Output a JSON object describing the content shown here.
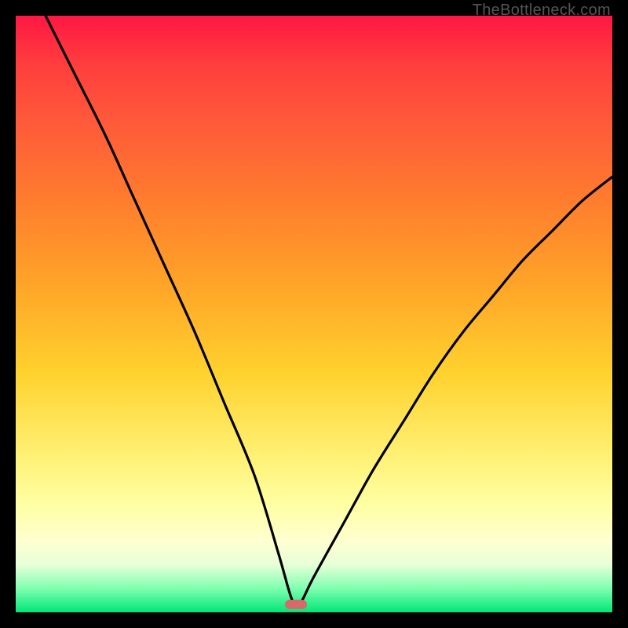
{
  "watermark": "TheBottleneck.com",
  "colors": {
    "frame_bg": "#000000",
    "curve": "#000000",
    "marker": "#d66a6a",
    "gradient_stops": [
      {
        "pct": 0,
        "color": "#ff1744"
      },
      {
        "pct": 8,
        "color": "#ff3d3d"
      },
      {
        "pct": 18,
        "color": "#ff5a3a"
      },
      {
        "pct": 30,
        "color": "#ff7a2e"
      },
      {
        "pct": 45,
        "color": "#ffa428"
      },
      {
        "pct": 60,
        "color": "#ffd22e"
      },
      {
        "pct": 74,
        "color": "#fff176"
      },
      {
        "pct": 82,
        "color": "#ffffa3"
      },
      {
        "pct": 88,
        "color": "#ffffd0"
      },
      {
        "pct": 92,
        "color": "#e8ffd8"
      },
      {
        "pct": 96,
        "color": "#7fffb0"
      },
      {
        "pct": 100,
        "color": "#00e676"
      }
    ]
  },
  "chart_data": {
    "type": "line",
    "title": "",
    "xlabel": "",
    "ylabel": "",
    "xlim": [
      0,
      100
    ],
    "ylim": [
      0,
      100
    ],
    "note": "x and y in percent of plot area; y = 0 at bottom (green), y = 100 at top (red). Single V-shaped curve with minimum near x≈47.",
    "series": [
      {
        "name": "bottleneck-curve",
        "x": [
          5,
          10,
          15,
          20,
          25,
          30,
          35,
          40,
          44,
          46,
          47,
          48,
          50,
          55,
          60,
          65,
          70,
          75,
          80,
          85,
          90,
          95,
          100
        ],
        "y": [
          100,
          90,
          80,
          69,
          58,
          47,
          35,
          23,
          10,
          3,
          1,
          2,
          6,
          15,
          24,
          32,
          40,
          47,
          53,
          59,
          64,
          69,
          73
        ]
      }
    ],
    "marker": {
      "x": 47,
      "y": 1
    }
  }
}
